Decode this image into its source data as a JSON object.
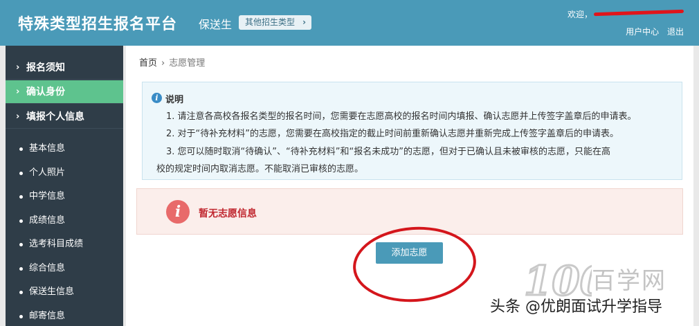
{
  "header": {
    "title": "特殊类型招生报名平台",
    "subtype": "保送生",
    "other_types_button": "其他招生类型",
    "welcome": "欢迎，",
    "user_center": "用户中心",
    "logout": "退出"
  },
  "sidebar": {
    "sections": [
      {
        "label": "报名须知"
      },
      {
        "label": "确认身份"
      },
      {
        "label": "填报个人信息"
      }
    ],
    "items": [
      {
        "label": "基本信息"
      },
      {
        "label": "个人照片"
      },
      {
        "label": "中学信息"
      },
      {
        "label": "成绩信息"
      },
      {
        "label": "选考科目成绩"
      },
      {
        "label": "综合信息"
      },
      {
        "label": "保送生信息"
      },
      {
        "label": "邮寄信息"
      }
    ]
  },
  "breadcrumb": {
    "home": "首页",
    "current": "志愿管理"
  },
  "info": {
    "title": "说明",
    "lines": [
      "1. 请注意各高校各报名类型的报名时间，您需要在志愿高校的报名时间内填报、确认志愿并上传签字盖章后的申请表。",
      "2. 对于“待补充材料”的志愿，您需要在高校指定的截止时间前重新确认志愿并重新完成上传签字盖章后的申请表。",
      "3. 您可以随时取消“待确认”、“待补充材料”和“报名未成功”的志愿，但对于已确认且未被审核的志愿，只能在高",
      "校的规定时间内取消志愿。不能取消已审核的志愿。"
    ]
  },
  "alert": {
    "message": "暂无志愿信息"
  },
  "add_button": "添加志愿",
  "watermark": {
    "logo_text": "100",
    "site": "百学网",
    "credit": "头条 @优朗面试升学指导"
  },
  "colors": {
    "header": "#4a9ab8",
    "sidebar": "#2f3d48",
    "active": "#5ec38e",
    "alert_text": "#c0262e",
    "annotation": "#d4161c"
  }
}
